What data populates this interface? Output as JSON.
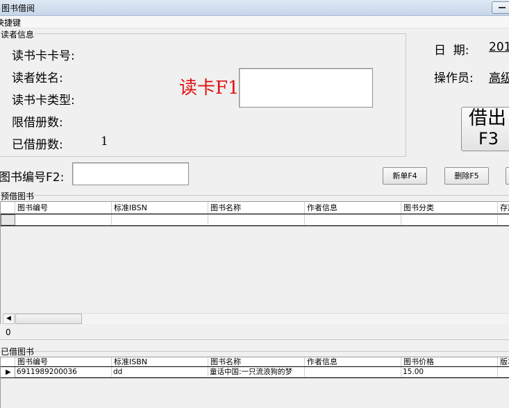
{
  "window": {
    "title": "图书借阅"
  },
  "menu": {
    "item": "快捷键"
  },
  "reader": {
    "group_title": "读者信息",
    "card_no_label": "读书卡卡号:",
    "name_label": "读者姓名:",
    "card_type_label": "读书卡类型:",
    "limit_label": "限借册数:",
    "borrowed_label": "已借册数:",
    "borrowed_value": "1",
    "read_card_label": "读卡F1",
    "read_card_input": ""
  },
  "info": {
    "date_label": "日  期:",
    "date_value": "201",
    "operator_label": "操作员:",
    "operator_value": "高级"
  },
  "borrow_button": {
    "line1": "借出",
    "line2": "F3"
  },
  "book_no": {
    "label": "图书编号F2:",
    "value": ""
  },
  "actions": {
    "new": "新单F4",
    "delete": "删除F5"
  },
  "pre_grid": {
    "title": "预借图书",
    "columns": [
      "图书编号",
      "标准IBSN",
      "图书名称",
      "作者信息",
      "图书分类",
      "存放"
    ],
    "rows": []
  },
  "count": "0",
  "borrowed_grid": {
    "title": "已借图书",
    "columns": [
      "图书编号",
      "标准ISBN",
      "图书名称",
      "作者信息",
      "图书价格",
      "版本"
    ],
    "rows": [
      {
        "no": "6911989200036",
        "isbn": "dd",
        "name": "童话中国:一只流浪狗的梦",
        "author": "",
        "price": "15.00",
        "edition": ""
      }
    ]
  },
  "colors": {
    "red_label": "#e01010",
    "group_border": "#c8c8c8"
  }
}
